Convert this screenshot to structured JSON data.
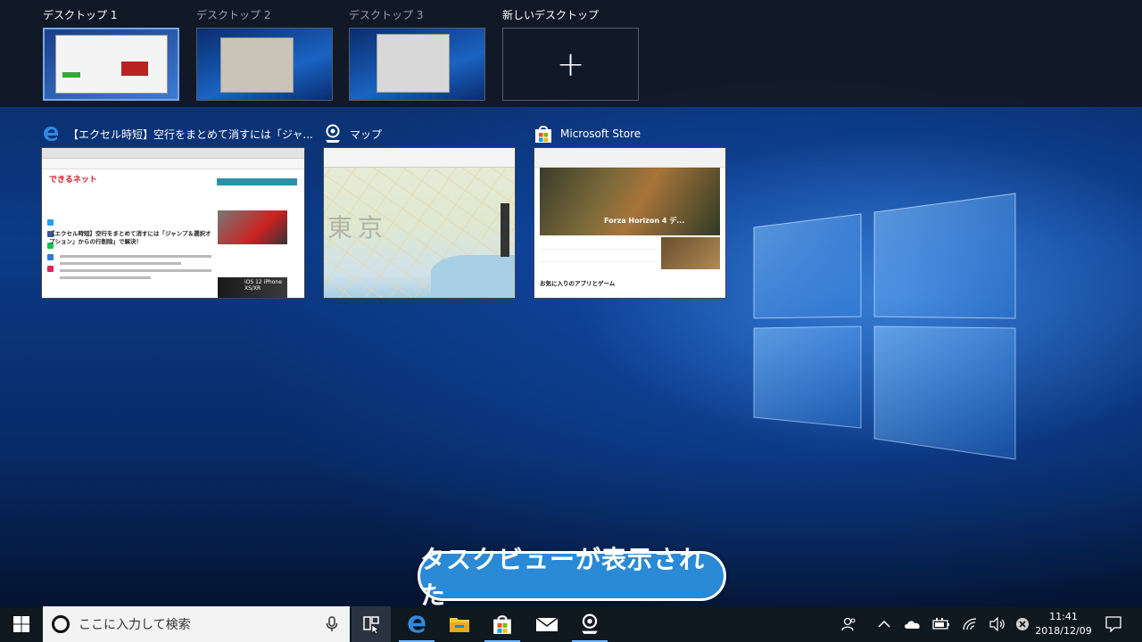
{
  "desktops": [
    {
      "label": "デスクトップ 1",
      "active": true
    },
    {
      "label": "デスクトップ 2",
      "active": false
    },
    {
      "label": "デスクトップ 3",
      "active": false
    }
  ],
  "new_desktop": {
    "label": "新しいデスクトップ",
    "icon": "plus-icon"
  },
  "windows": [
    {
      "title": "【エクセル時短】空行をまとめて消すには「ジャ...",
      "icon": "edge-icon",
      "thumb": {
        "site_logo": "できるネット",
        "headline": "【エクセル時短】空行をまとめて消すには「ジャンプ＆選択オプション」からの行削除」で解決！",
        "side_text": "iOS 12 iPhone XS/XR"
      }
    },
    {
      "title": "マップ",
      "icon": "maps-icon",
      "thumb": {
        "label": "東京"
      }
    },
    {
      "title": "Microsoft Store",
      "icon": "store-icon",
      "thumb": {
        "hero": "Forza Horizon 4 デ...",
        "section": "お気に入りのアプリとゲーム"
      }
    }
  ],
  "caption": "タスクビューが表示された",
  "taskbar": {
    "search_placeholder": "ここに入力して検索",
    "apps": [
      "edge-icon",
      "file-explorer-icon",
      "store-icon",
      "mail-icon",
      "maps-icon"
    ],
    "clock_time": "11:41",
    "clock_date": "2018/12/09"
  },
  "colors": {
    "accent": "#2a8ad6",
    "taskbar": "#101820",
    "strip": "#12182a"
  }
}
